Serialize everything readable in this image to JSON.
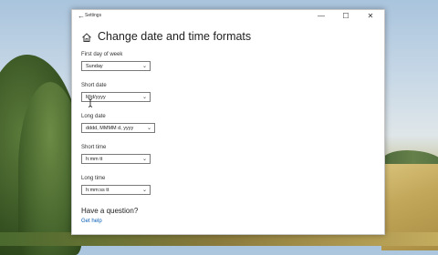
{
  "window": {
    "title": "Settings",
    "back_glyph": "←",
    "minimize_glyph": "—",
    "maximize_glyph": "☐",
    "close_glyph": "✕"
  },
  "page": {
    "title": "Change date and time formats",
    "home_icon": "home-icon"
  },
  "fields": [
    {
      "label": "First day of week",
      "value": "Sunday"
    },
    {
      "label": "Short date",
      "value": "M/d/yyyy"
    },
    {
      "label": "Long date",
      "value": "dddd, MMMM d, yyyy"
    },
    {
      "label": "Short time",
      "value": "h:mm tt"
    },
    {
      "label": "Long time",
      "value": "h:mm:ss tt"
    }
  ],
  "help": {
    "title": "Have a question?",
    "link": "Get help"
  },
  "chevron_glyph": "⌄"
}
